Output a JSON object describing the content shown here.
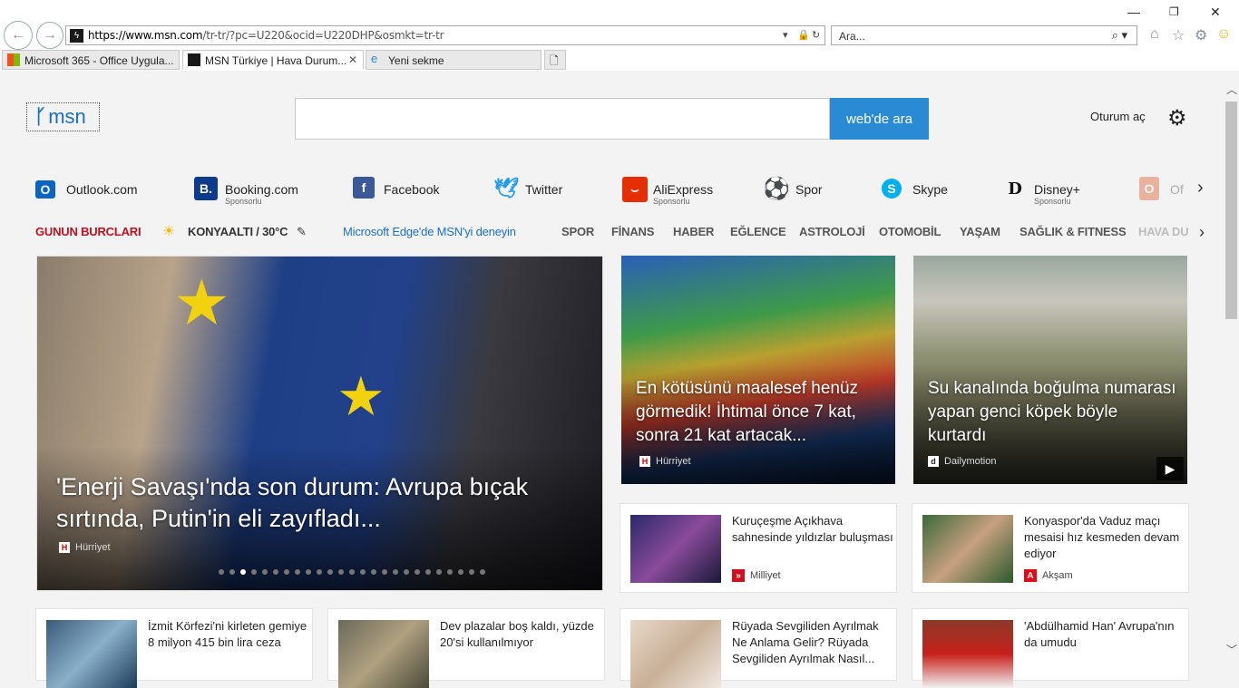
{
  "browser": {
    "url_domain": "https://www.msn.com",
    "url_rest": "/tr-tr/?pc=U220&ocid=U220DHP&osmkt=tr-tr",
    "search_placeholder": "Ara...",
    "tabs": [
      {
        "label": "Microsoft 365 - Office Uygula..."
      },
      {
        "label": "MSN Türkiye | Hava Durum..."
      },
      {
        "label": "Yeni sekme"
      }
    ]
  },
  "header": {
    "logo": "msn",
    "search_button": "web'de ara",
    "signin": "Oturum aç"
  },
  "quicklinks": [
    {
      "label": "Outlook.com",
      "sub": ""
    },
    {
      "label": "Booking.com",
      "sub": "Sponsorlu"
    },
    {
      "label": "Facebook",
      "sub": ""
    },
    {
      "label": "Twitter",
      "sub": ""
    },
    {
      "label": "AliExpress",
      "sub": "Sponsorlu"
    },
    {
      "label": "Spor",
      "sub": ""
    },
    {
      "label": "Skype",
      "sub": ""
    },
    {
      "label": "Disney+",
      "sub": "Sponsorlu"
    },
    {
      "label": "Of",
      "sub": ""
    }
  ],
  "catbar": {
    "horoscope": "GUNUN BURCLARI",
    "weather": "KONYAALTI / 30°C",
    "edge_promo": "Microsoft Edge'de MSN'yi deneyin",
    "categories": [
      "SPOR",
      "FİNANS",
      "HABER",
      "EĞLENCE",
      "ASTROLOJİ",
      "OTOMOBİL",
      "YAŞAM",
      "SAĞLIK & FITNESS",
      "HAVA DU"
    ]
  },
  "hero": {
    "title": "'Enerji Savaşı'nda son durum: Avrupa bıçak sırtında, Putin'in eli zayıfladı...",
    "source": "Hürriyet"
  },
  "feature_cards": [
    {
      "title": "En kötüsünü maalesef henüz görmedik! İhtimal önce 7 kat, sonra 21 kat artacak...",
      "source": "Hürriyet"
    },
    {
      "title": "Su kanalında boğulma numarası yapan genci köpek böyle kurtardı",
      "source": "Dailymotion"
    }
  ],
  "small_cards": [
    {
      "title": "Kuruçeşme Açıkhava sahnesinde yıldızlar buluşması",
      "source": "Milliyet"
    },
    {
      "title": "Konyaspor'da Vaduz maçı mesaisi hız kesmeden devam ediyor",
      "source": "Akşam"
    },
    {
      "title": "İzmit Körfezi'ni kirleten gemiye 8 milyon 415 bin lira ceza",
      "source": ""
    },
    {
      "title": "Dev plazalar boş kaldı, yüzde 20'si kullanılmıyor",
      "source": ""
    },
    {
      "title": "Rüyada Sevgiliden Ayrılmak Ne Anlama Gelir? Rüyada Sevgiliden Ayrılmak Nasıl...",
      "source": ""
    },
    {
      "title": "'Abdülhamid Han' Avrupa'nın da umudu",
      "source": ""
    }
  ],
  "colors": {
    "accent": "#2a8ad4",
    "horoscope": "#c0111f",
    "promo": "#1a6fc4"
  }
}
